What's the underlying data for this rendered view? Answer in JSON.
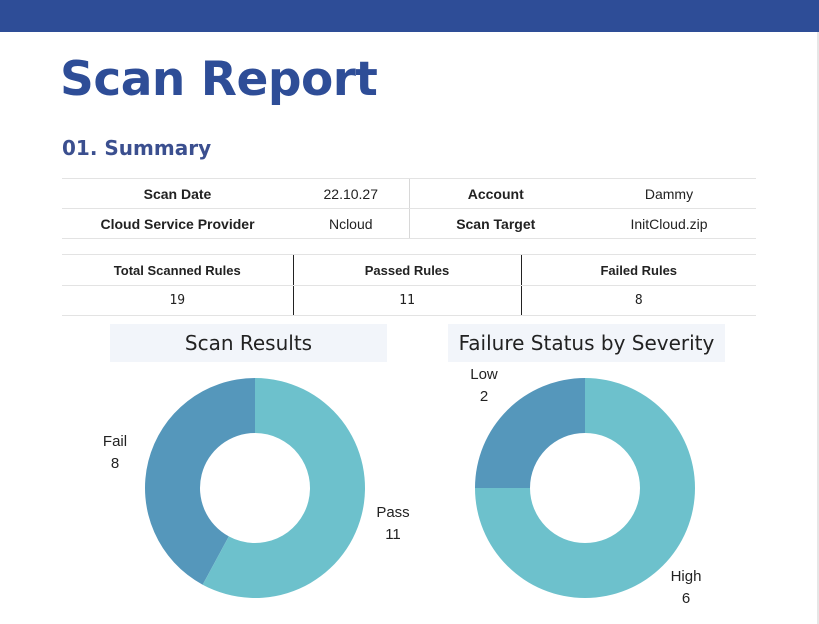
{
  "title": "Scan Report",
  "summary": {
    "heading": "01. Summary",
    "rows": [
      [
        {
          "label": "Scan Date",
          "value": "22.10.27"
        },
        {
          "label": "Account",
          "value": "Dammy"
        }
      ],
      [
        {
          "label": "Cloud Service Provider",
          "value": "Ncloud"
        },
        {
          "label": "Scan Target",
          "value": "InitCloud.zip"
        }
      ]
    ],
    "rules": {
      "headers": [
        "Total Scanned Rules",
        "Passed Rules",
        "Failed Rules"
      ],
      "values": [
        "19",
        "11",
        "8"
      ]
    }
  },
  "colors": {
    "brand": "#2e4d97",
    "dark_slice": "#5597bb",
    "light_slice": "#6dc1cc"
  },
  "chart_data": [
    {
      "type": "pie",
      "title": "Scan Results",
      "donut": true,
      "slices": [
        {
          "label": "Fail",
          "value": 8
        },
        {
          "label": "Pass",
          "value": 11
        }
      ]
    },
    {
      "type": "pie",
      "title": "Failure Status by Severity",
      "donut": true,
      "slices": [
        {
          "label": "Low",
          "value": 2
        },
        {
          "label": "High",
          "value": 6
        }
      ]
    }
  ]
}
